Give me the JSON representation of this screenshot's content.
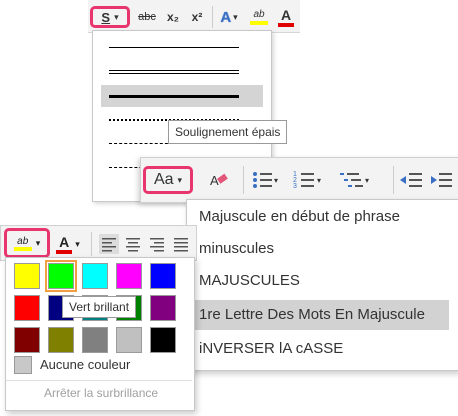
{
  "top_ribbon": {
    "underline_glyph": "S",
    "strikethrough_glyph": "abc",
    "subscript_glyph": "x₂",
    "superscript_glyph": "x²",
    "text_effects_glyph": "A",
    "highlight_glyph": "ab",
    "font_color_glyph": "A"
  },
  "underline_menu": {
    "styles": [
      "single",
      "double",
      "thick",
      "dotted",
      "dashed",
      "dash-dot"
    ],
    "selected_index": 2
  },
  "tooltip_underline": "Soulignement épais",
  "right_ribbon": {
    "change_case_glyph": "Aa"
  },
  "case_menu": {
    "items": [
      {
        "label": "Majuscule en début de phrase"
      },
      {
        "label": "minuscules"
      },
      {
        "label": "MAJUSCULES"
      },
      {
        "label": "1re Lettre Des Mots En Majuscule"
      },
      {
        "label": "iNVERSER lA cASSE"
      }
    ],
    "selected_index": 3
  },
  "left_ribbon": {
    "highlight_glyph": "ab",
    "font_color_glyph": "A"
  },
  "highlight_palette": {
    "colors": [
      "#ffff00",
      "#00ff00",
      "#00ffff",
      "#ff00ff",
      "#0000ff",
      "#ff0000",
      "#000080",
      "#008080",
      "#008000",
      "#800080",
      "#800000",
      "#808000",
      "#808080",
      "#c0c0c0",
      "#000000"
    ],
    "selected_index": 1,
    "no_color_label": "Aucune couleur",
    "stop_label": "Arrêter la surbrillance"
  },
  "tooltip_color": "Vert brillant",
  "colors": {
    "highlight_box": "#e8356d",
    "selected_swatch": "#f0a040"
  }
}
